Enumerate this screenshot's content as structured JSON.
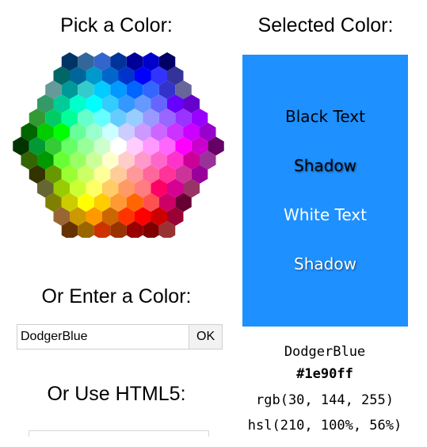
{
  "headings": {
    "pick": "Pick a Color:",
    "selected": "Selected Color:",
    "enter": "Or Enter a Color:",
    "html5": "Or Use HTML5:"
  },
  "color_input": {
    "value": "DodgerBlue"
  },
  "ok_button": {
    "label": "OK"
  },
  "selected": {
    "color": "#1e90ff",
    "black_text": "Black Text",
    "black_shadow": "Shadow",
    "white_text": "White Text",
    "white_shadow": "Shadow",
    "name": "DodgerBlue",
    "hex": "#1e90ff",
    "rgb": "rgb(30, 144, 255)",
    "hsl": "hsl(210, 100%, 56%)"
  },
  "hex_map": {
    "rows": [
      [
        "#003366",
        "#336699",
        "#3366cc",
        "#003399",
        "#000099",
        "#0000cc",
        "#000066"
      ],
      [
        "#006666",
        "#006699",
        "#0099cc",
        "#0066cc",
        "#0033cc",
        "#0000ff",
        "#3333ff",
        "#333399"
      ],
      [
        "#669999",
        "#009999",
        "#33cccc",
        "#00ccff",
        "#0099ff",
        "#0066ff",
        "#3366ff",
        "#3333cc",
        "#666699"
      ],
      [
        "#339966",
        "#00cc99",
        "#00ffcc",
        "#00ffff",
        "#33ccff",
        "#3399ff",
        "#6699ff",
        "#6666ff",
        "#6600ff",
        "#6600cc"
      ],
      [
        "#339933",
        "#00cc66",
        "#00ff99",
        "#66ffcc",
        "#66ffff",
        "#66ccff",
        "#99ccff",
        "#9999ff",
        "#9966ff",
        "#9933ff",
        "#9900ff"
      ],
      [
        "#006600",
        "#00cc00",
        "#00ff00",
        "#66ff99",
        "#99ffcc",
        "#ccffff",
        "#ccccff",
        "#cc99ff",
        "#cc66ff",
        "#cc33ff",
        "#cc00ff",
        "#9900cc"
      ],
      [
        "#003300",
        "#009933",
        "#33cc33",
        "#66ff66",
        "#99ff99",
        "#ccffcc",
        "#ffffff",
        "#ffccff",
        "#ff99ff",
        "#ff66ff",
        "#ff00ff",
        "#cc00cc",
        "#660066"
      ],
      [
        "#336600",
        "#009900",
        "#66ff33",
        "#99ff66",
        "#ccff99",
        "#ffffcc",
        "#ffcccc",
        "#ff99cc",
        "#ff66cc",
        "#ff33cc",
        "#cc0099",
        "#993399"
      ],
      [
        "#333300",
        "#669900",
        "#99ff33",
        "#ccff66",
        "#ffff99",
        "#ffcc99",
        "#ff9999",
        "#ff6699",
        "#ff3399",
        "#cc3399",
        "#990099"
      ],
      [
        "#666633",
        "#99cc00",
        "#ccff33",
        "#ffff66",
        "#ffcc66",
        "#ff9966",
        "#ff7c80",
        "#ff0066",
        "#d60093",
        "#993366"
      ],
      [
        "#808000",
        "#cccc00",
        "#ffff00",
        "#ffcc00",
        "#ff9933",
        "#ff6600",
        "#ff5050",
        "#cc0066",
        "#660033"
      ],
      [
        "#996633",
        "#cc9900",
        "#ff9900",
        "#cc6600",
        "#ff3300",
        "#ff0000",
        "#cc0000",
        "#990033"
      ],
      [
        "#663300",
        "#996600",
        "#cc3300",
        "#993300",
        "#990000",
        "#800000",
        "#993333"
      ]
    ]
  }
}
